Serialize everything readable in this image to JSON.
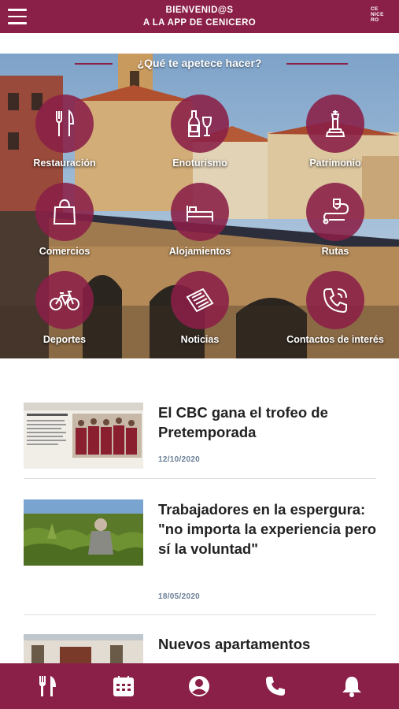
{
  "header": {
    "line1": "BIENVENID@S",
    "line2": "A LA APP DE CENICERO",
    "logo_lines": [
      "CE",
      "NICE",
      "RO"
    ],
    "menu_icon": "hamburger-menu-icon"
  },
  "hero": {
    "heading": "¿Qué te apetece hacer?",
    "categories": [
      {
        "label": "Restauración",
        "icon": "cutlery-icon"
      },
      {
        "label": "Enoturismo",
        "icon": "wine-bottle-glass-icon"
      },
      {
        "label": "Patrimonio",
        "icon": "monument-icon"
      },
      {
        "label": "Comercios",
        "icon": "shopping-bag-icon"
      },
      {
        "label": "Alojamientos",
        "icon": "bed-icon"
      },
      {
        "label": "Rutas",
        "icon": "route-icon"
      },
      {
        "label": "Deportes",
        "icon": "bicycle-icon"
      },
      {
        "label": "Noticias",
        "icon": "newspaper-icon"
      },
      {
        "label": "Contactos de interés",
        "icon": "phone-icon"
      }
    ]
  },
  "news": [
    {
      "title": "El CBC gana el trofeo de Pretemporada",
      "date": "12/10/2020"
    },
    {
      "title": "Trabajadores en la espergura: \"no importa la experiencia pero sí la voluntad\"",
      "date": "18/05/2020"
    },
    {
      "title": "Nuevos apartamentos",
      "date": ""
    }
  ],
  "bottom_nav": [
    {
      "icon": "cutlery-icon"
    },
    {
      "icon": "calendar-icon"
    },
    {
      "icon": "user-icon"
    },
    {
      "icon": "phone-icon"
    },
    {
      "icon": "bell-icon"
    }
  ],
  "colors": {
    "brand": "#8a1f47",
    "date": "#6a7f95",
    "title": "#222222"
  }
}
